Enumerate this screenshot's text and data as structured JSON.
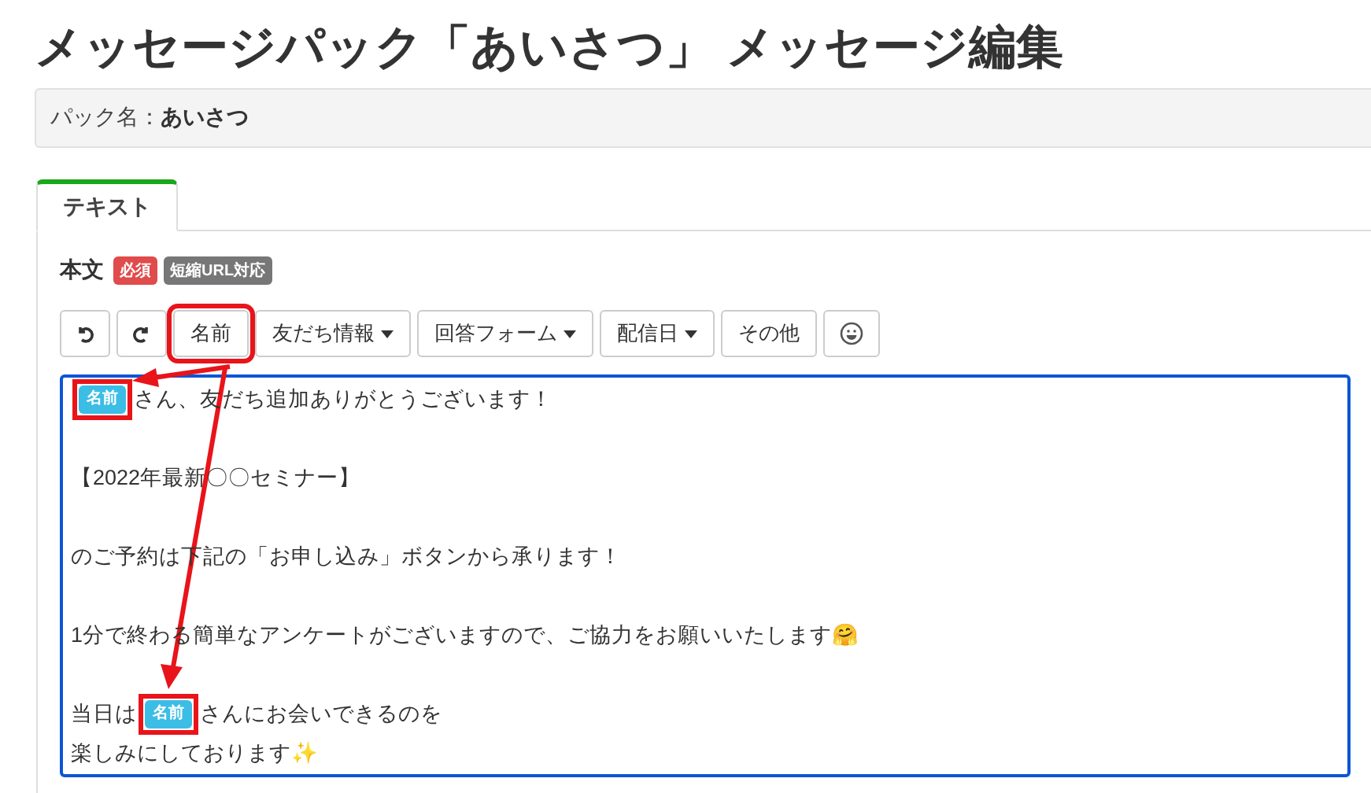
{
  "page_title": "メッセージパック「あいさつ」 メッセージ編集",
  "pack_name": {
    "label": "パック名：",
    "value": "あいさつ"
  },
  "tabs": [
    {
      "label": "テキスト",
      "selected": true
    }
  ],
  "body_field": {
    "label": "本文",
    "badges": [
      {
        "text": "必須",
        "color": "#e04b4b"
      },
      {
        "text": "短縮URL対応",
        "color": "#777777"
      }
    ]
  },
  "toolbar": [
    {
      "kind": "undo"
    },
    {
      "kind": "redo"
    },
    {
      "kind": "text",
      "label": "名前",
      "annotated": true
    },
    {
      "kind": "dropdown",
      "label": "友だち情報"
    },
    {
      "kind": "dropdown",
      "label": "回答フォーム"
    },
    {
      "kind": "dropdown",
      "label": "配信日"
    },
    {
      "kind": "text",
      "label": "その他"
    },
    {
      "kind": "emoji"
    }
  ],
  "editor_lines": [
    {
      "blank_line_before": false,
      "segments": [
        {
          "kind": "tag",
          "text": "名前",
          "annotated": true
        },
        {
          "kind": "text",
          "text": "さん、友だち追加ありがとうございます！"
        }
      ]
    },
    {
      "blank_line_before": true,
      "segments": [
        {
          "kind": "text",
          "text": "【2022年最新〇〇セミナー】"
        }
      ]
    },
    {
      "blank_line_before": true,
      "segments": [
        {
          "kind": "text",
          "text": "のご予約は下記の「お申し込み」ボタンから承ります！"
        }
      ]
    },
    {
      "blank_line_before": true,
      "segments": [
        {
          "kind": "text",
          "text": "1分で終わる簡単なアンケートがございますので、ご協力をお願いいたします🤗"
        }
      ]
    },
    {
      "blank_line_before": true,
      "segments": [
        {
          "kind": "text",
          "text": "当日は"
        },
        {
          "kind": "tag",
          "text": "名前",
          "annotated": true
        },
        {
          "kind": "text",
          "text": "さんにお会いできるのを"
        }
      ]
    },
    {
      "blank_line_before": false,
      "segments": [
        {
          "kind": "text",
          "text": "楽しみにしております✨"
        }
      ]
    }
  ]
}
